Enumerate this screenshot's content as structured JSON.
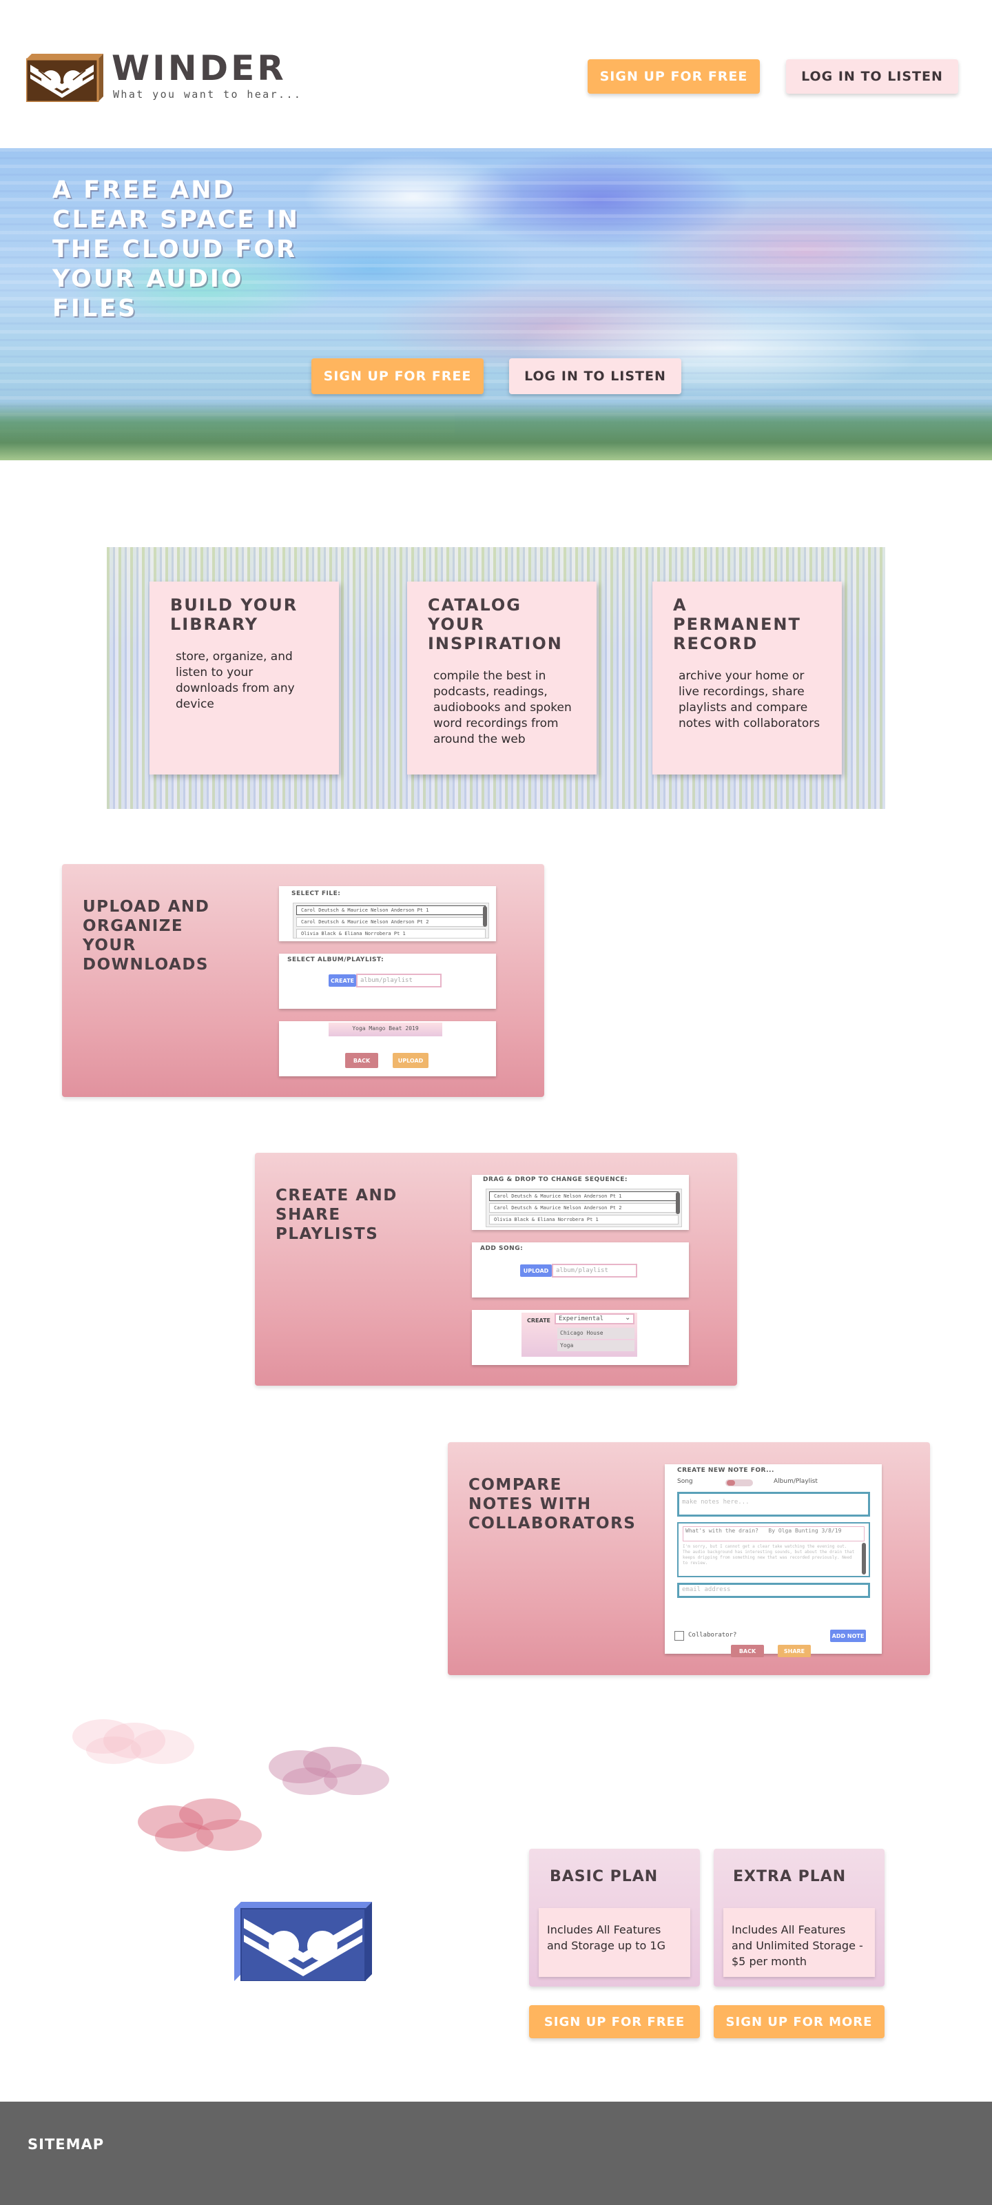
{
  "brand": {
    "name": "WINDER",
    "tagline": "What you want to hear..."
  },
  "header": {
    "signup_label": "SIGN UP FOR FREE",
    "login_label": "LOG IN TO LISTEN"
  },
  "hero": {
    "title": "A FREE AND CLEAR SPACE IN THE CLOUD FOR YOUR AUDIO FILES",
    "signup_label": "SIGN UP FOR FREE",
    "login_label": "LOG IN TO LISTEN"
  },
  "features": [
    {
      "title": "BUILD YOUR LIBRARY",
      "text": "store, organize, and listen to your downloads from any device"
    },
    {
      "title": "CATALOG YOUR INSPIRATION",
      "text": "compile the best in podcasts, readings, audiobooks and spoken word recordings from around the web"
    },
    {
      "title": "A PERMANENT RECORD",
      "text": "archive your home or live recordings, share playlists and compare notes with collaborators"
    }
  ],
  "upload_section": {
    "title": "UPLOAD AND ORGANIZE YOUR DOWNLOADS",
    "select_file_label": "SELECT FILE:",
    "files": [
      "Carol Deutsch & Maurice Nelson Anderson Pt 1",
      "Carol Deutsch & Maurice Nelson Anderson Pt 2",
      "Olivia Black & Eliana Norrobera Pt 1"
    ],
    "select_album_label": "SELECT ALBUM/PLAYLIST:",
    "create_label": "CREATE",
    "album_placeholder": "album/playlist",
    "album_value": "Yoga Mango Beat 2019",
    "back_label": "BACK",
    "upload_label": "UPLOAD"
  },
  "playlist_section": {
    "title": "CREATE AND SHARE PLAYLISTS",
    "drag_label": "DRAG & DROP TO CHANGE SEQUENCE:",
    "files": [
      "Carol Deutsch & Maurice Nelson Anderson Pt 1",
      "Carol Deutsch & Maurice Nelson Anderson Pt 2",
      "Olivia Black & Eliana Norrobera Pt 1"
    ],
    "add_song_label": "ADD SONG:",
    "upload_label": "UPLOAD",
    "album_placeholder": "album/playlist",
    "create_label": "CREATE",
    "dropdown_selected": "Experimental",
    "dropdown_options": [
      "Chicago House",
      "Yoga"
    ]
  },
  "notes_section": {
    "title": "COMPARE NOTES WITH COLLABORATORS",
    "new_note_label": "CREATE NEW NOTE FOR...",
    "song_label": "Song",
    "album_label": "Album/Playlist",
    "note_placeholder": "make notes here...",
    "sample_note_title": "What's with the drain?",
    "sample_note_by": "By Olga Bunting 3/8/19",
    "sample_note_body": "I'm sorry, but I cannot get a clear take watching the evening out. The audio background has interesting sounds, but about the drain that keeps dripping from something new that was recorded previously. Need to review.",
    "email_placeholder": "email address",
    "collaborator_label": "Collaborator?",
    "add_note_label": "ADD NOTE",
    "back_label": "BACK",
    "share_label": "SHARE"
  },
  "plans": [
    {
      "title": "BASIC PLAN",
      "text": "Includes All Features and Storage up to 1G",
      "button": "SIGN UP FOR FREE"
    },
    {
      "title": "EXTRA PLAN",
      "text": "Includes All Features and Unlimited Storage - $5 per month",
      "button": "SIGN UP FOR MORE"
    }
  ],
  "footer": {
    "sitemap_label": "SITEMAP"
  },
  "colors": {
    "accent_orange": "#ffb55e",
    "accent_pink": "#fde3e6",
    "panel_pink": "#e9a6af",
    "logo_brown": "#5a3518",
    "logo_blue": "#3f57a8",
    "footer_gray": "#646464"
  },
  "icons": {
    "logo": "cassette-wing-logo",
    "hero_logo": "blue-cassette-wing-logo"
  }
}
